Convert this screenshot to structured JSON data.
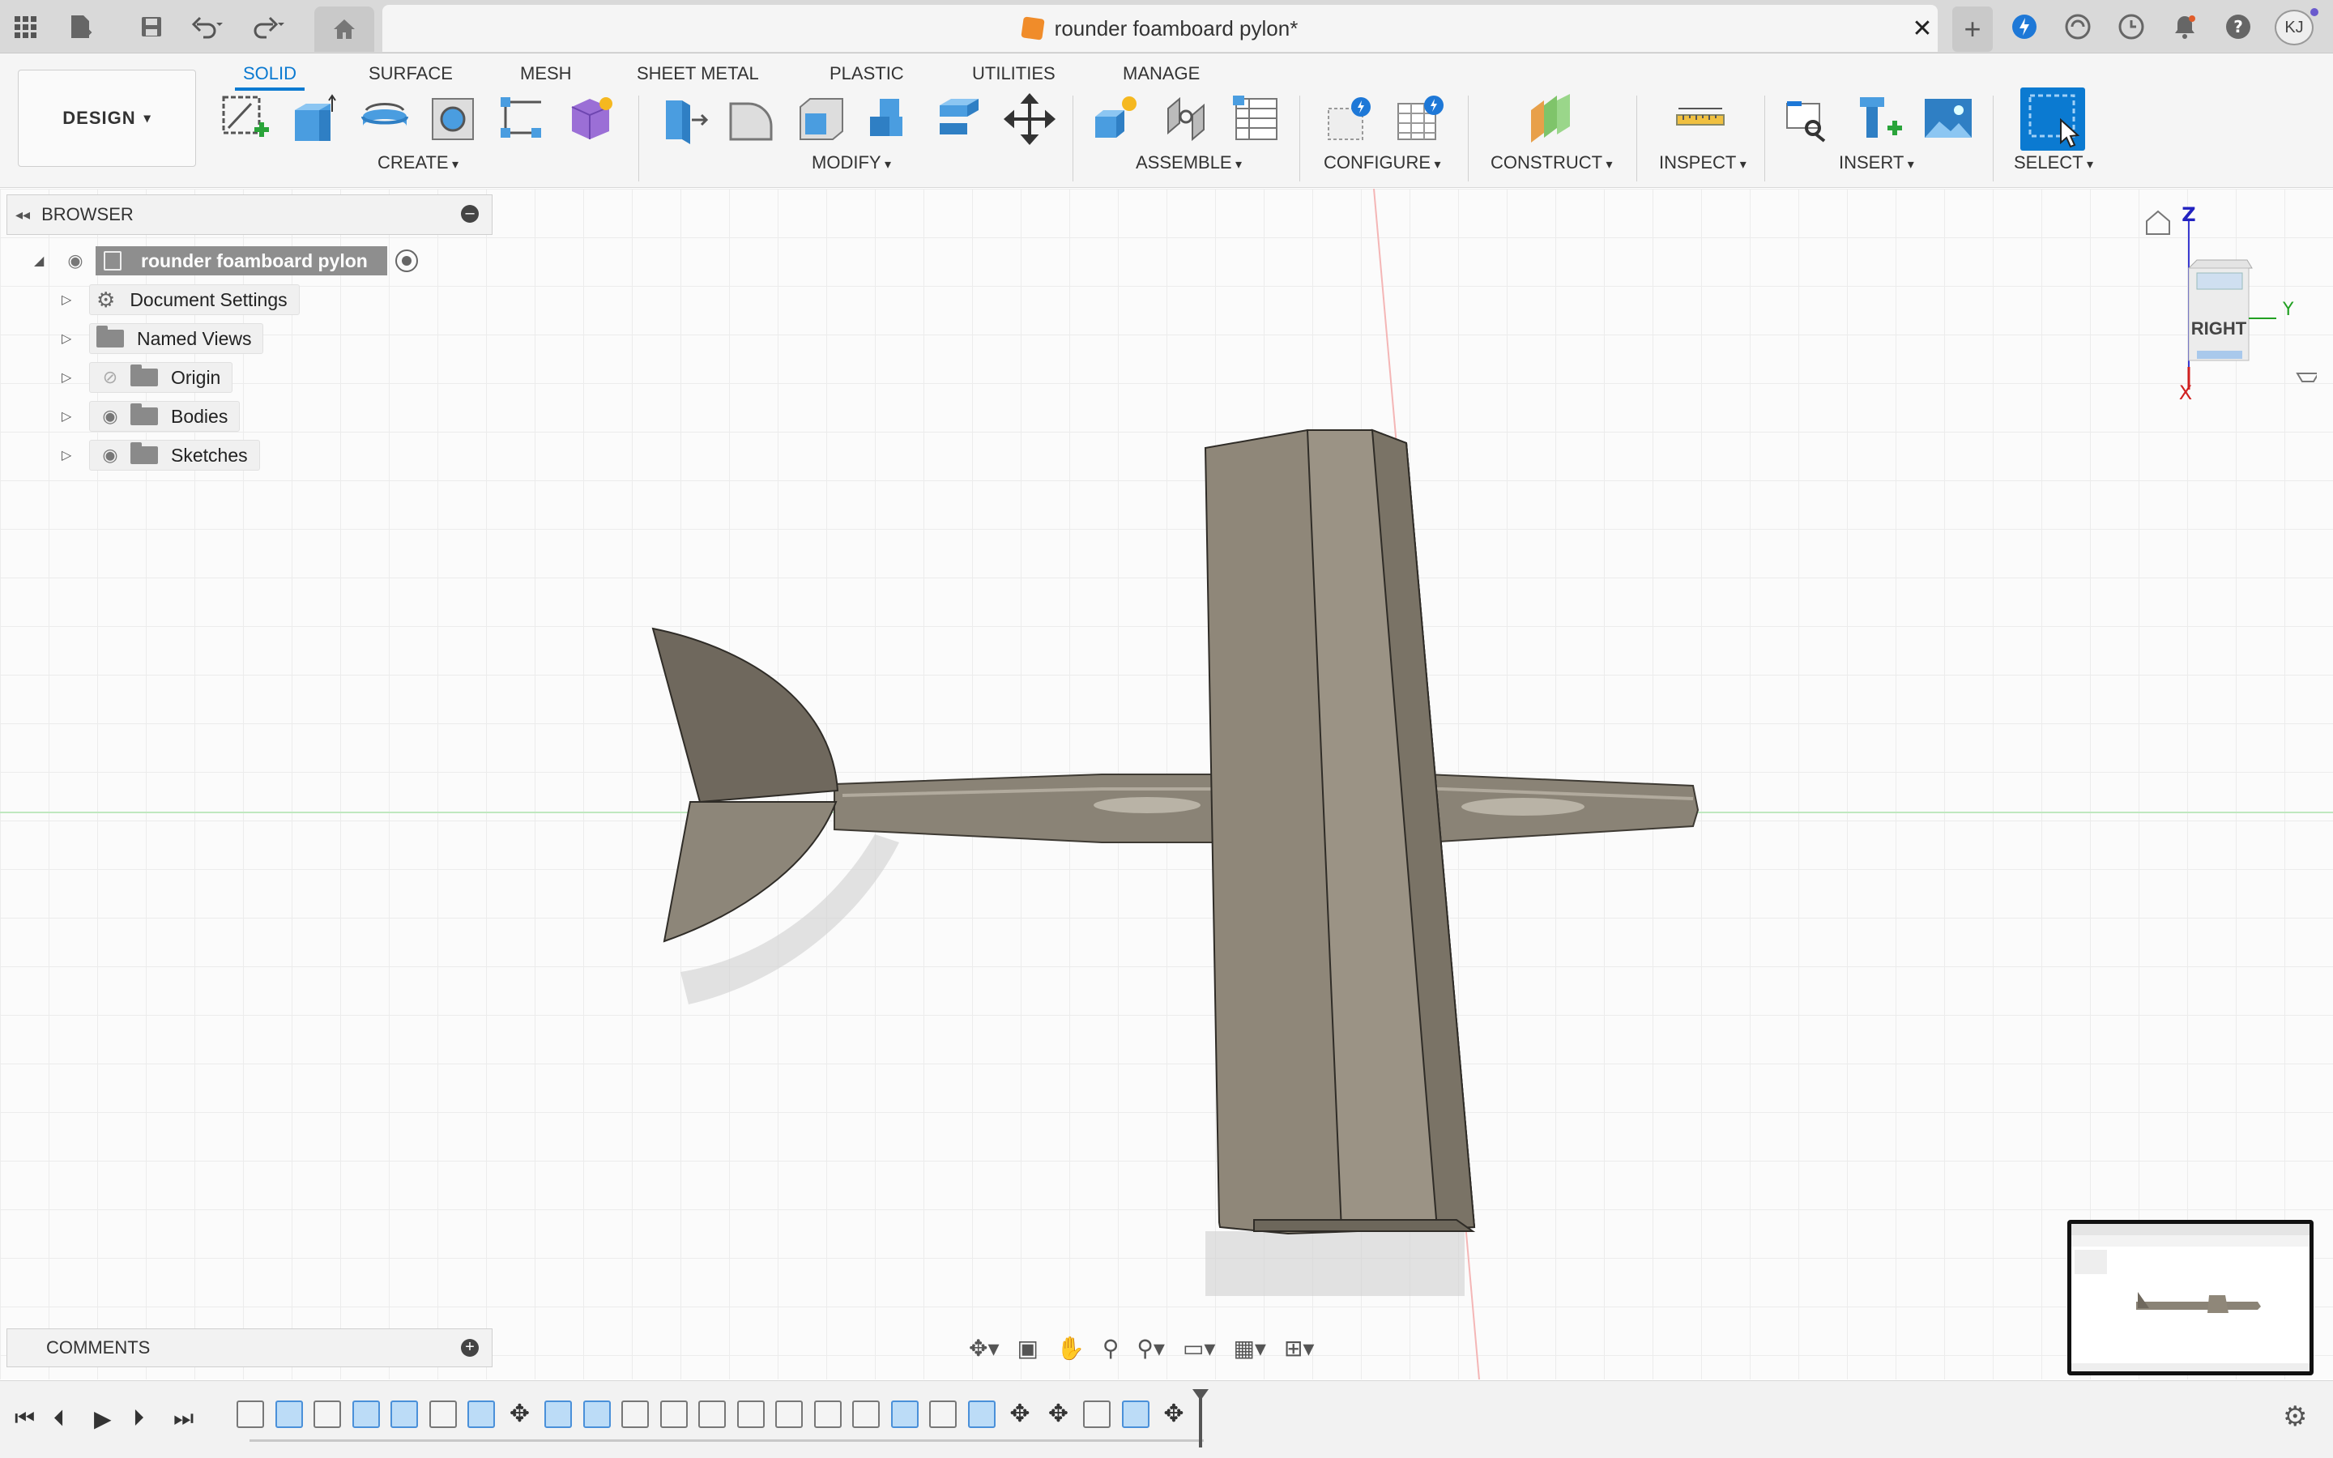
{
  "window": {
    "doc_title": "rounder foamboard pylon*",
    "user_initials": "KJ"
  },
  "workspace": {
    "mode": "DESIGN",
    "tabs": [
      {
        "label": "SOLID",
        "active": true
      },
      {
        "label": "SURFACE",
        "active": false
      },
      {
        "label": "MESH",
        "active": false
      },
      {
        "label": "SHEET METAL",
        "active": false
      },
      {
        "label": "PLASTIC",
        "active": false
      },
      {
        "label": "UTILITIES",
        "active": false
      },
      {
        "label": "MANAGE",
        "active": false
      }
    ],
    "groups": [
      "CREATE",
      "MODIFY",
      "ASSEMBLE",
      "CONFIGURE",
      "CONSTRUCT",
      "INSPECT",
      "INSERT",
      "SELECT"
    ]
  },
  "browser": {
    "title": "BROWSER",
    "root": "rounder foamboard pylon",
    "items": [
      "Document Settings",
      "Named Views",
      "Origin",
      "Bodies",
      "Sketches"
    ]
  },
  "comments": {
    "title": "COMMENTS"
  },
  "viewcube": {
    "face": "RIGHT",
    "axis_z": "Z",
    "axis_y": "Y",
    "axis_x": "X"
  },
  "colors": {
    "accent": "#0b7ad1",
    "model": "#8f8779",
    "model_dark": "#6f675c"
  }
}
